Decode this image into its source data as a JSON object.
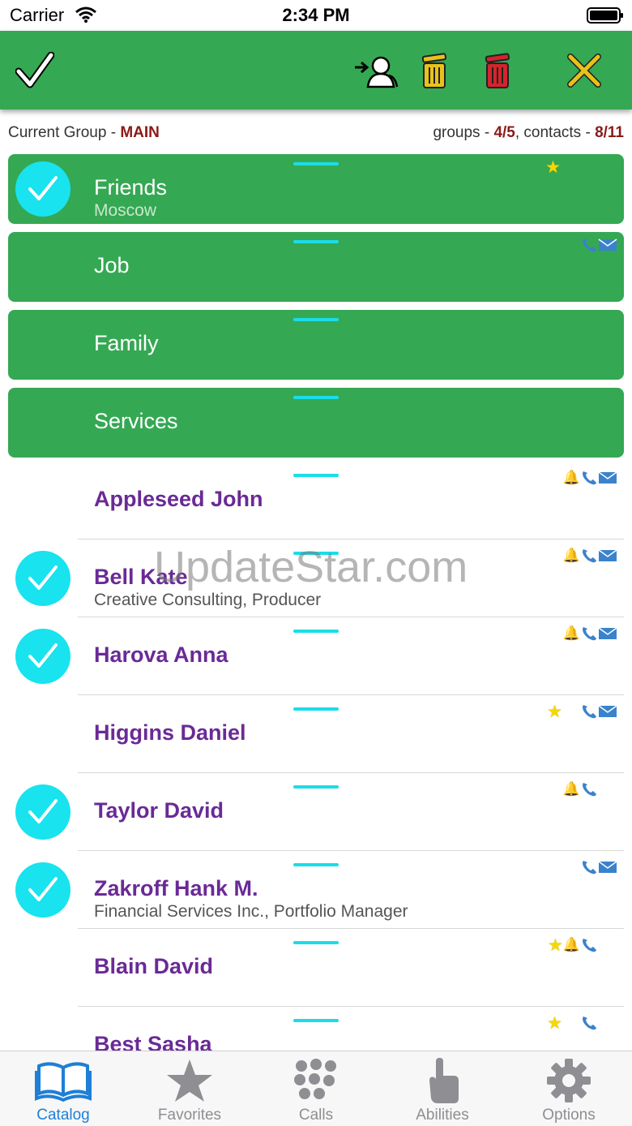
{
  "status_bar": {
    "carrier": "Carrier",
    "time": "2:34 PM"
  },
  "toolbar": {
    "buttons": [
      {
        "name": "confirm",
        "icon": "checkmark-icon"
      },
      {
        "name": "move-contacts",
        "icon": "move-to-group-icon"
      },
      {
        "name": "clear",
        "icon": "yellow-trash-icon"
      },
      {
        "name": "delete",
        "icon": "red-trash-icon"
      },
      {
        "name": "cancel",
        "icon": "close-icon"
      }
    ],
    "colors": {
      "bar": "#35a853",
      "yellow_trash": "#e8c21a",
      "red_trash": "#d3252b",
      "close": "#e8c21a"
    }
  },
  "info": {
    "current_group_label": "Current Group - ",
    "current_group_value": "MAIN",
    "groups_label": "groups - ",
    "groups_value": "4/5",
    "contacts_label": ", contacts - ",
    "contacts_value": "8/11"
  },
  "groups": [
    {
      "title": "Friends",
      "subtitle": "Moscow",
      "checked": true,
      "badges": [
        "star-icon"
      ]
    },
    {
      "title": "Job",
      "subtitle": "",
      "checked": false,
      "badges": [
        "phone-icon",
        "mail-icon"
      ]
    },
    {
      "title": "Family",
      "subtitle": "",
      "checked": false,
      "badges": []
    },
    {
      "title": "Services",
      "subtitle": "",
      "checked": false,
      "badges": []
    }
  ],
  "contacts": [
    {
      "name": "Appleseed John",
      "subtitle": "",
      "checked": false,
      "badges": [
        "birthday-icon",
        "phone-icon",
        "mail-icon"
      ]
    },
    {
      "name": "Bell Kate",
      "subtitle": "Creative Consulting, Producer",
      "checked": true,
      "badges": [
        "birthday-icon",
        "phone-icon",
        "mail-icon"
      ]
    },
    {
      "name": "Harova Anna",
      "subtitle": "",
      "checked": true,
      "badges": [
        "birthday-icon",
        "phone-icon",
        "mail-icon"
      ]
    },
    {
      "name": "Higgins Daniel",
      "subtitle": "",
      "checked": false,
      "badges": [
        "star-icon",
        "phone-icon",
        "mail-icon"
      ]
    },
    {
      "name": "Taylor David",
      "subtitle": "",
      "checked": true,
      "badges": [
        "birthday-icon",
        "phone-icon"
      ]
    },
    {
      "name": "Zakroff Hank M.",
      "subtitle": "Financial Services Inc., Portfolio Manager",
      "checked": true,
      "badges": [
        "phone-icon",
        "mail-icon"
      ]
    },
    {
      "name": "Blain David",
      "subtitle": "",
      "checked": false,
      "badges": [
        "star-icon",
        "birthday-icon",
        "phone-icon"
      ]
    },
    {
      "name": "Best Sasha",
      "subtitle": "",
      "checked": false,
      "badges": [
        "star-icon",
        "phone-icon"
      ]
    }
  ],
  "watermark": "UpdateStar.com",
  "tabs": [
    {
      "label": "Catalog",
      "icon": "book-icon",
      "active": true
    },
    {
      "label": "Favorites",
      "icon": "star-icon",
      "active": false
    },
    {
      "label": "Calls",
      "icon": "keypad-icon",
      "active": false
    },
    {
      "label": "Abilities",
      "icon": "hand-pointer-icon",
      "active": false
    },
    {
      "label": "Options",
      "icon": "gear-icon",
      "active": false
    }
  ],
  "colors": {
    "contact_name": "#6a2a96",
    "check_circle": "#18e3ee",
    "handle": "#1adde9",
    "tab_active": "#1d7fd6",
    "tab_inactive": "#8e8e93"
  }
}
